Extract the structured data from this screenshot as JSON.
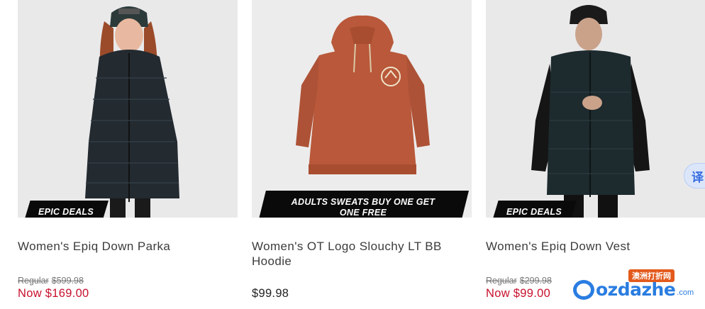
{
  "products": [
    {
      "badge": "EPIC DEALS",
      "title": "Women's Epiq Down Parka",
      "regular_label": "Regular",
      "regular_price": "$599.98",
      "now_price": "Now $169.00",
      "colors": {
        "garment": "#232a30",
        "background": "#e9e9ea"
      }
    },
    {
      "badge": "ADULTS SWEATS BUY ONE GET ONE FREE",
      "title": "Women's OT Logo Slouchy LT BB Hoodie",
      "price": "$99.98",
      "colors": {
        "garment": "#b9583a",
        "background": "#ececec"
      }
    },
    {
      "badge": "EPIC DEALS",
      "title": "Women's Epiq Down Vest",
      "regular_label": "Regular",
      "regular_price": "$299.98",
      "now_price": "Now $99.00",
      "colors": {
        "garment": "#1d2a2e",
        "background": "#e9e9ea"
      }
    }
  ],
  "translate_button": {
    "label": "译",
    "icon": "translate-icon"
  },
  "watermark": {
    "top_text": "澳洲打折网",
    "brand": "ozdazhe",
    "suffix": ".com"
  },
  "colors": {
    "sale_red": "#c8102e",
    "badge_black": "#0a0a0a",
    "text_gray": "#3c3c3c"
  }
}
